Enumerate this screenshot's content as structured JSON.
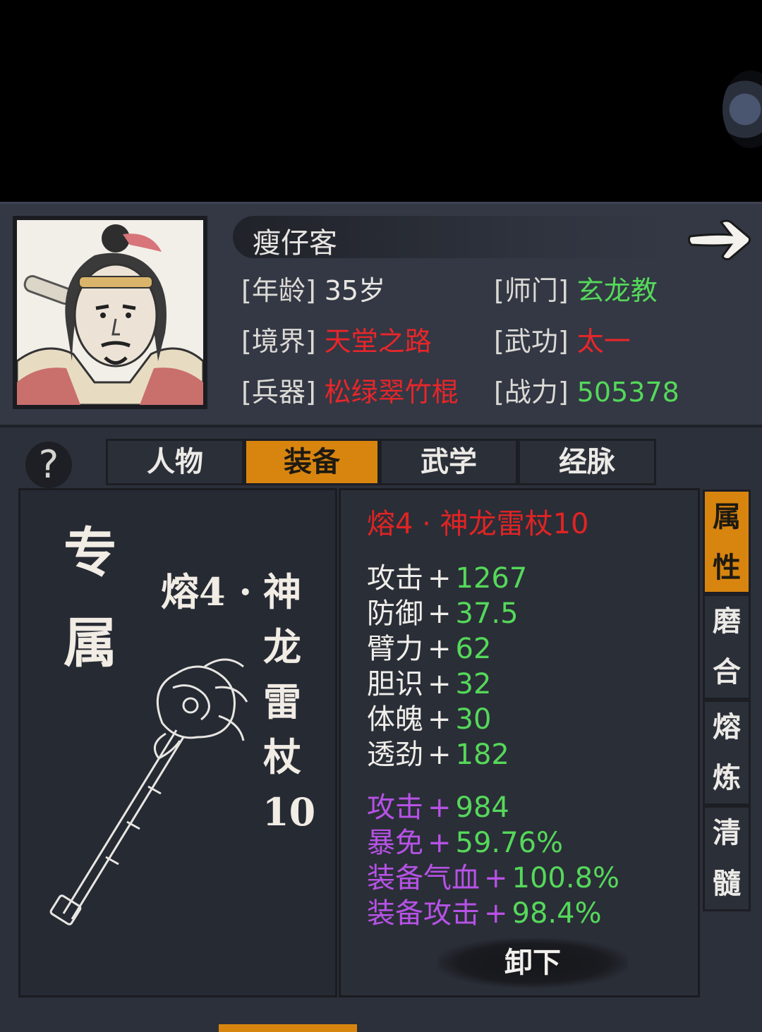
{
  "character": {
    "name": "瘦仔客",
    "age_label": "[年龄]",
    "age_value": "35岁",
    "sect_label": "[师门]",
    "sect_value": "玄龙教",
    "realm_label": "[境界]",
    "realm_value": "天堂之路",
    "martial_label": "[武功]",
    "martial_value": "太一",
    "weapon_label": "[兵器]",
    "weapon_value": "松绿翠竹棍",
    "power_label": "[战力]",
    "power_value": "505378"
  },
  "help": "?",
  "tabs": [
    "人物",
    "装备",
    "武学",
    "经脉"
  ],
  "active_tab": "装备",
  "left": {
    "exclusive_top": "专",
    "exclusive_bottom": "属",
    "prefix": "熔4 ·",
    "name_chars": [
      "神",
      "龙",
      "雷",
      "杖",
      "10"
    ]
  },
  "item": {
    "title": "熔4 · 神龙雷杖10",
    "base_stats": [
      {
        "name": "攻击",
        "value": "1267"
      },
      {
        "name": "防御",
        "value": "37.5"
      },
      {
        "name": "臂力",
        "value": "62"
      },
      {
        "name": "胆识",
        "value": "32"
      },
      {
        "name": "体魄",
        "value": "30"
      },
      {
        "name": "透劲",
        "value": "182"
      }
    ],
    "bonus_stats": [
      {
        "name": "攻击",
        "value": "984"
      },
      {
        "name": "暴免",
        "value": "59.76%"
      },
      {
        "name": "装备气血",
        "value": "100.8%"
      },
      {
        "name": "装备攻击",
        "value": "98.4%"
      }
    ],
    "plus": "+"
  },
  "unequip_label": "卸下",
  "side_tabs": [
    {
      "chars": [
        "属",
        "性"
      ],
      "active": true
    },
    {
      "chars": [
        "磨",
        "合"
      ],
      "active": false
    },
    {
      "chars": [
        "熔",
        "炼"
      ],
      "active": false
    },
    {
      "chars": [
        "清",
        "髓"
      ],
      "active": false
    }
  ],
  "colors": {
    "accent": "#d8850f",
    "red": "#e8262a",
    "green": "#55d85a",
    "purple": "#b652e6"
  }
}
